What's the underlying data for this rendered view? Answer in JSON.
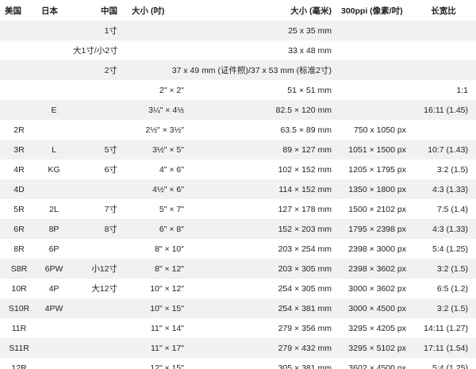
{
  "headers": [
    "美国",
    "日本",
    "中国",
    "大小 (吋)",
    "大小 (毫米)",
    "300ppi (像素/吋)",
    "长宽比"
  ],
  "rows": [
    [
      "",
      "",
      "1寸",
      "",
      "25 x 35 mm",
      "",
      ""
    ],
    [
      "",
      "",
      "大1寸/小2寸",
      "",
      "33 x 48 mm",
      "",
      ""
    ],
    [
      "",
      "",
      "2寸",
      "",
      "37 x 49 mm (证件照)/37 x 53 mm (标准2寸)",
      "",
      ""
    ],
    [
      "",
      "",
      "",
      "2\" × 2\"",
      "51 × 51 mm",
      "",
      "1:1"
    ],
    [
      "",
      "E",
      "",
      "3¼\" × 4½",
      "82.5 × 120 mm",
      "",
      "16:11 (1.45)"
    ],
    [
      "2R",
      "",
      "",
      "2½\" × 3½\"",
      "63.5 × 89 mm",
      "750 x 1050 px",
      ""
    ],
    [
      "3R",
      "L",
      "5寸",
      "3½\" × 5\"",
      "89 × 127 mm",
      "1051 × 1500 px",
      "10:7 (1.43)"
    ],
    [
      "4R",
      "KG",
      "6寸",
      "4\" × 6\"",
      "102 × 152 mm",
      "1205 × 1795 px",
      "3:2 (1.5)"
    ],
    [
      "4D",
      "",
      "",
      "4½\" × 6\"",
      "114 × 152 mm",
      "1350 × 1800 px",
      "4:3 (1.33)"
    ],
    [
      "5R",
      "2L",
      "7寸",
      "5\" × 7\"",
      "127 × 178 mm",
      "1500 × 2102 px",
      "7:5 (1.4)"
    ],
    [
      "6R",
      "8P",
      "8寸",
      "6\" × 8\"",
      "152 × 203 mm",
      "1795 × 2398 px",
      "4:3 (1.33)"
    ],
    [
      "8R",
      "6P",
      "",
      "8\" × 10\"",
      "203 × 254 mm",
      "2398 × 3000 px",
      "5:4 (1.25)"
    ],
    [
      "S8R",
      "6PW",
      "小12寸",
      "8\" × 12\"",
      "203 × 305 mm",
      "2398 × 3602 px",
      "3:2 (1.5)"
    ],
    [
      "10R",
      "4P",
      "大12寸",
      "10\" × 12\"",
      "254 × 305 mm",
      "3000 × 3602 px",
      "6:5 (1.2)"
    ],
    [
      "S10R",
      "4PW",
      "",
      "10\" × 15\"",
      "254 × 381 mm",
      "3000 × 4500 px",
      "3:2 (1.5)"
    ],
    [
      "11R",
      "",
      "",
      "11\" × 14\"",
      "279 × 356 mm",
      "3295 × 4205 px",
      "14:11 (1.27)"
    ],
    [
      "S11R",
      "",
      "",
      "11\" × 17\"",
      "279 × 432 mm",
      "3295 × 5102 px",
      "17:11 (1.54)"
    ],
    [
      "12R",
      "",
      "",
      "12\" × 15\"",
      "305 × 381 mm",
      "3602 × 4500 px",
      "5:4 (1.25)"
    ]
  ],
  "spans": {
    "2": {
      "from_col": 3,
      "colspan": 2
    }
  }
}
